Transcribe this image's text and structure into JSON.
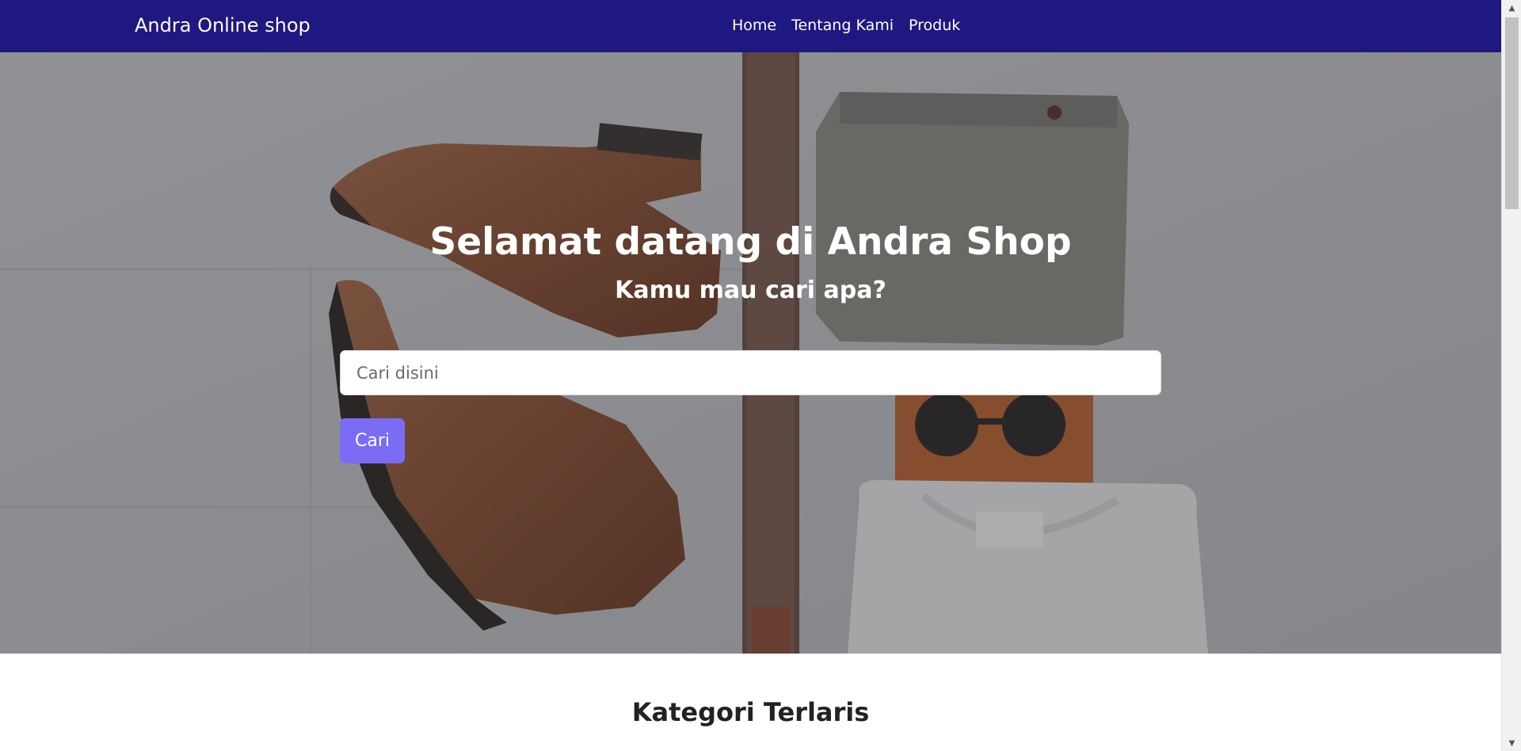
{
  "navbar": {
    "brand": "Andra Online shop",
    "links": [
      "Home",
      "Tentang Kami",
      "Produk"
    ]
  },
  "hero": {
    "title": "Selamat datang di Andra Shop",
    "subtitle": "Kamu mau cari apa?",
    "search_placeholder": "Cari disini",
    "search_value": "",
    "search_button": "Cari",
    "background_image": "flat-lay photo of brown leather boots, belt, checked trousers, sunglasses and white t-shirt"
  },
  "sections": {
    "kategori_title": "Kategori Terlaris"
  },
  "colors": {
    "navbar": "#1e1880",
    "button": "#7b6cf5",
    "text_light": "#ffffff",
    "text_dark": "#222222"
  },
  "icons": {
    "scroll_up": "triangle-up-icon",
    "scroll_down": "triangle-down-icon"
  }
}
